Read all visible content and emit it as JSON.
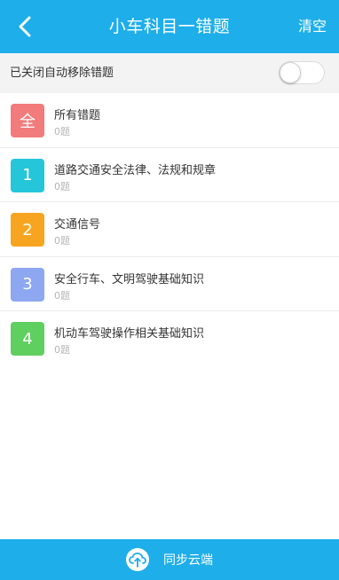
{
  "header": {
    "title": "小车科目一错题",
    "clear_label": "清空"
  },
  "auto_remove": {
    "label": "已关闭自动移除错题",
    "enabled": false
  },
  "categories": [
    {
      "badge": "全",
      "title": "所有错题",
      "count": "0题",
      "color": "#f27b7b"
    },
    {
      "badge": "1",
      "title": "道路交通安全法律、法规和规章",
      "count": "0题",
      "color": "#26c6da"
    },
    {
      "badge": "2",
      "title": "交通信号",
      "count": "0题",
      "color": "#f7a520"
    },
    {
      "badge": "3",
      "title": "安全行车、文明驾驶基础知识",
      "count": "0题",
      "color": "#8da7f0"
    },
    {
      "badge": "4",
      "title": "机动车驾驶操作相关基础知识",
      "count": "0题",
      "color": "#5fcf5f"
    }
  ],
  "footer": {
    "sync_label": "同步云端"
  },
  "colors": {
    "primary": "#1eaeea"
  }
}
